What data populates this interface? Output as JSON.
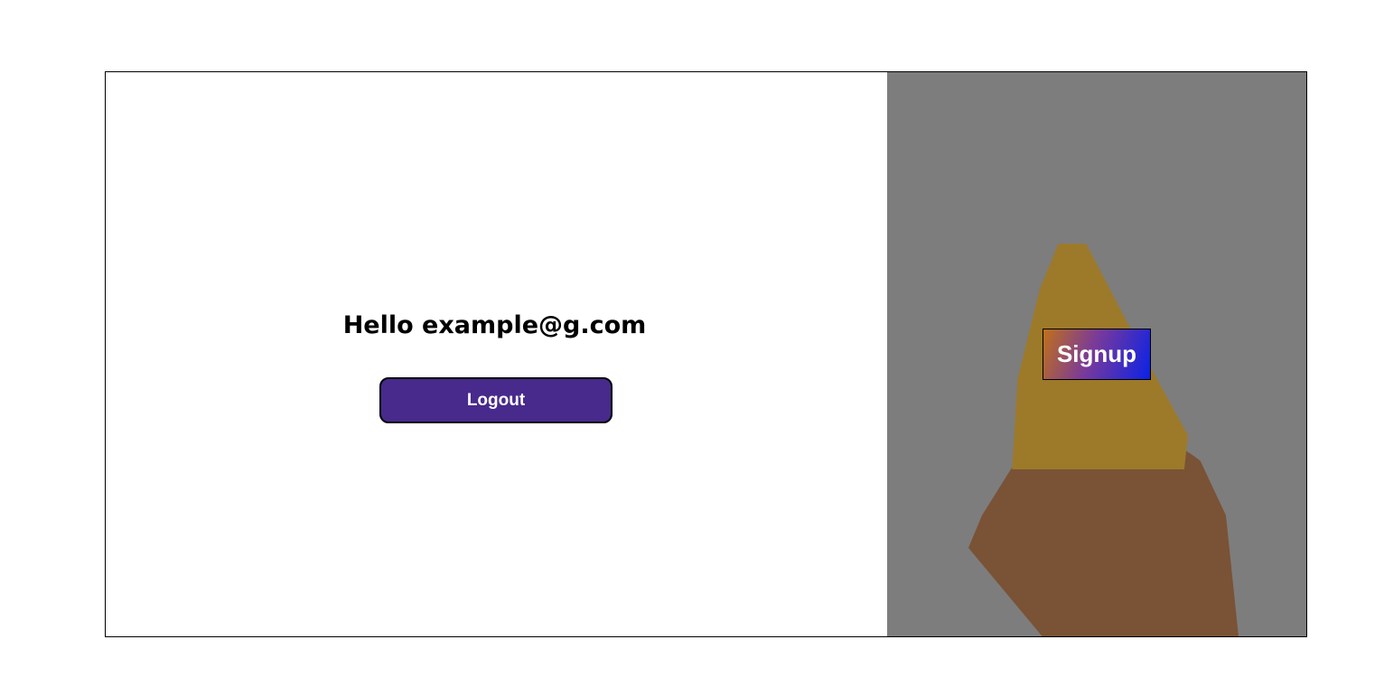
{
  "greeting": "Hello example@g.com",
  "logout_label": "Logout",
  "signup_label": "Signup"
}
